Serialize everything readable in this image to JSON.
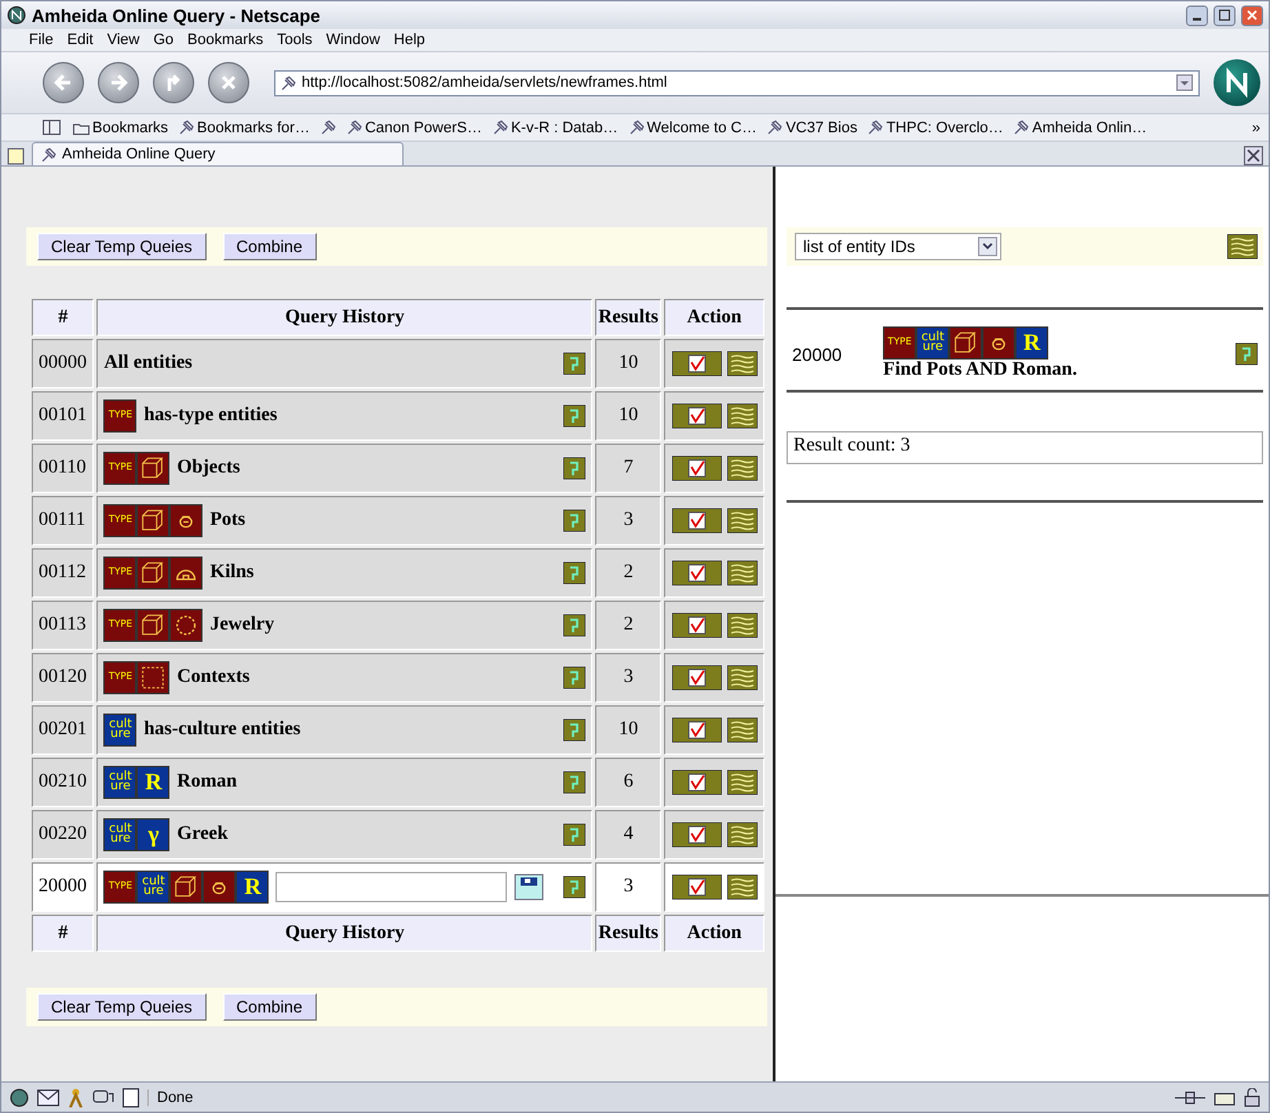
{
  "window": {
    "title": "Amheida Online Query - Netscape"
  },
  "menu": [
    "File",
    "Edit",
    "View",
    "Go",
    "Bookmarks",
    "Tools",
    "Window",
    "Help"
  ],
  "address": {
    "value": "http://localhost:5082/amheida/servlets/newframes.html"
  },
  "bookmarks": [
    {
      "kind": "folder",
      "label": "Bookmarks"
    },
    {
      "kind": "link",
      "label": "Bookmarks for…"
    },
    {
      "kind": "icon"
    },
    {
      "kind": "link",
      "label": "Canon PowerS…"
    },
    {
      "kind": "link",
      "label": "K-v-R : Datab…"
    },
    {
      "kind": "link",
      "label": "Welcome to C…"
    },
    {
      "kind": "link",
      "label": "VC37 Bios"
    },
    {
      "kind": "link",
      "label": "THPC: Overclo…"
    },
    {
      "kind": "link",
      "label": "Amheida Onlin…"
    }
  ],
  "bookmarks_more": "»",
  "tabs": [
    {
      "label": "Amheida Online Query",
      "selected": true
    }
  ],
  "left": {
    "top_buttons": [
      "Clear Temp Queies",
      "Combine"
    ],
    "table": {
      "columns": [
        "#",
        "Query History",
        "Results",
        "Action"
      ],
      "rows": [
        {
          "kind": "query",
          "id": "00000",
          "icons": [],
          "title": "All entities",
          "results": "10"
        },
        {
          "kind": "query",
          "id": "00101",
          "icons": [
            {
              "kind": "type",
              "text": "TYPE"
            }
          ],
          "title": "has-type entities",
          "results": "10"
        },
        {
          "kind": "query",
          "id": "00110",
          "icons": [
            {
              "kind": "type",
              "text": "TYPE"
            },
            {
              "kind": "object"
            }
          ],
          "title": "Objects",
          "results": "7"
        },
        {
          "kind": "query",
          "id": "00111",
          "icons": [
            {
              "kind": "type",
              "text": "TYPE"
            },
            {
              "kind": "object"
            },
            {
              "kind": "pot"
            }
          ],
          "title": "Pots",
          "results": "3"
        },
        {
          "kind": "query",
          "id": "00112",
          "icons": [
            {
              "kind": "type",
              "text": "TYPE"
            },
            {
              "kind": "object"
            },
            {
              "kind": "kiln"
            }
          ],
          "title": "Kilns",
          "results": "2"
        },
        {
          "kind": "query",
          "id": "00113",
          "icons": [
            {
              "kind": "type",
              "text": "TYPE"
            },
            {
              "kind": "object"
            },
            {
              "kind": "jewelry"
            }
          ],
          "title": "Jewelry",
          "results": "2"
        },
        {
          "kind": "query",
          "id": "00120",
          "icons": [
            {
              "kind": "type",
              "text": "TYPE"
            },
            {
              "kind": "context"
            }
          ],
          "title": "Contexts",
          "results": "3"
        },
        {
          "kind": "query",
          "id": "00201",
          "icons": [
            {
              "kind": "culture",
              "lines": [
                "cult",
                "ure"
              ]
            }
          ],
          "title": "has-culture entities",
          "results": "10"
        },
        {
          "kind": "query",
          "id": "00210",
          "icons": [
            {
              "kind": "culture",
              "lines": [
                "cult",
                "ure"
              ]
            },
            {
              "kind": "roman",
              "text": "R"
            }
          ],
          "title": "Roman",
          "results": "6"
        },
        {
          "kind": "query",
          "id": "00220",
          "icons": [
            {
              "kind": "culture",
              "lines": [
                "cult",
                "ure"
              ]
            },
            {
              "kind": "greek",
              "text": "γ"
            }
          ],
          "title": "Greek",
          "results": "4"
        },
        {
          "kind": "draft",
          "id": "20000",
          "icons": [
            {
              "kind": "type",
              "text": "TYPE"
            },
            {
              "kind": "culture",
              "lines": [
                "cult",
                "ure"
              ]
            },
            {
              "kind": "object"
            },
            {
              "kind": "pot"
            },
            {
              "kind": "roman",
              "text": "R"
            }
          ],
          "results": "3"
        }
      ],
      "footer": [
        "#",
        "Query History",
        "Results",
        "Action"
      ]
    },
    "bottom_buttons": [
      "Clear Temp Queies",
      "Combine"
    ]
  },
  "right": {
    "select": {
      "value": "list of entity IDs"
    },
    "result": {
      "id": "20000",
      "icons": [
        {
          "kind": "type",
          "text": "TYPE"
        },
        {
          "kind": "culture",
          "lines": [
            "cult",
            "ure"
          ]
        },
        {
          "kind": "object"
        },
        {
          "kind": "pot"
        },
        {
          "kind": "roman",
          "text": "R"
        }
      ],
      "description": "Find Pots AND Roman."
    },
    "count": "Result count: 3"
  },
  "status_bar": {
    "text": "Done"
  }
}
